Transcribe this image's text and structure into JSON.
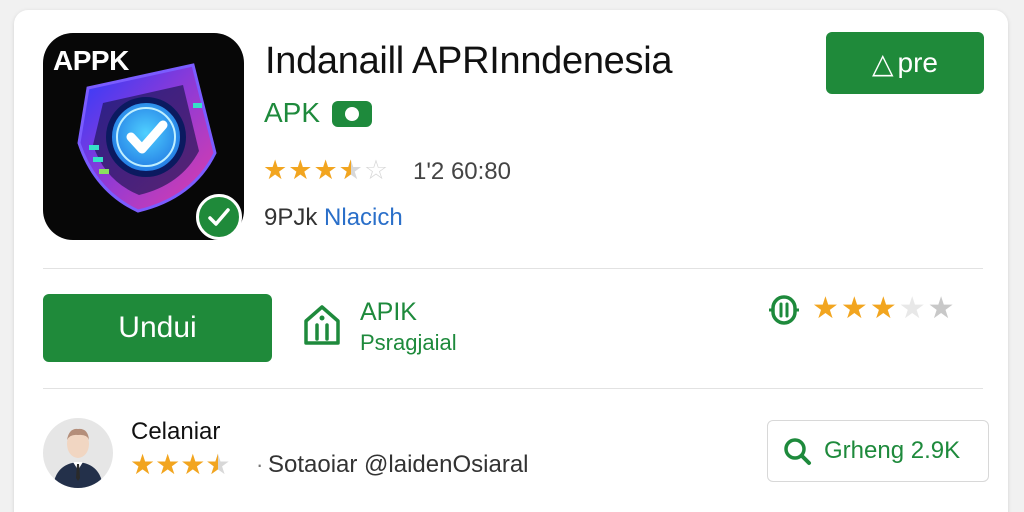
{
  "app": {
    "icon_tag": "APPK",
    "title": "Indanaill APRInndenesia",
    "subtitle": "APK",
    "rating": 3.5,
    "count_text": "1'2 60:80",
    "developer_part1": "9PJk",
    "developer_part2": "Nlacich"
  },
  "header": {
    "top_button_label": "pre",
    "top_button_glyph": "△"
  },
  "actions": {
    "download_label": "Undui",
    "apk_label": "APIK",
    "apk_sublabel": "Psragjaial",
    "rating_stars": 3
  },
  "review": {
    "reviewer_name": "Celaniar",
    "rating": 3.5,
    "separator": "·",
    "text": "Sotaoiar @laidenOsiaral",
    "search_button_label": "Grheng 2.9K"
  },
  "colors": {
    "brand_green": "#1f8a3a",
    "star_gold": "#f2a51f",
    "link_blue": "#2a6fc9"
  },
  "icons": [
    "shield-check-icon",
    "verified-badge-icon",
    "apk-box-icon",
    "rating-info-icon",
    "search-icon",
    "avatar-icon"
  ]
}
